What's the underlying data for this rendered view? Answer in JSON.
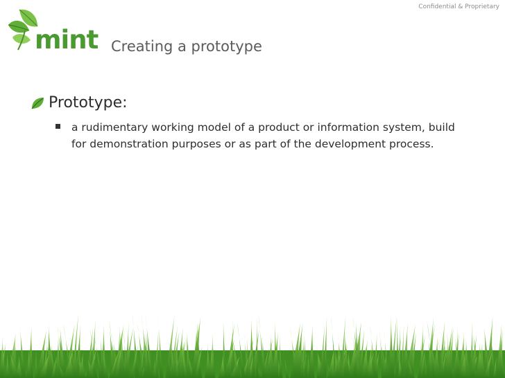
{
  "header": {
    "confidential": "Confidential & Proprietary",
    "logo_text": "mint",
    "logo_icon": "mint-leaf-logo"
  },
  "slide": {
    "title": "Creating a prototype",
    "bullet_icon": "leaf-bullet",
    "bullet_1": "Prototype:",
    "bullet_1_sub": "a rudimentary working model of a product or information system, build for demonstration purposes or as part of the development process."
  },
  "decor": {
    "grass": "grass-footer",
    "colors": {
      "brand_green": "#4a9a31",
      "title_gray": "#5b5b5b"
    }
  }
}
